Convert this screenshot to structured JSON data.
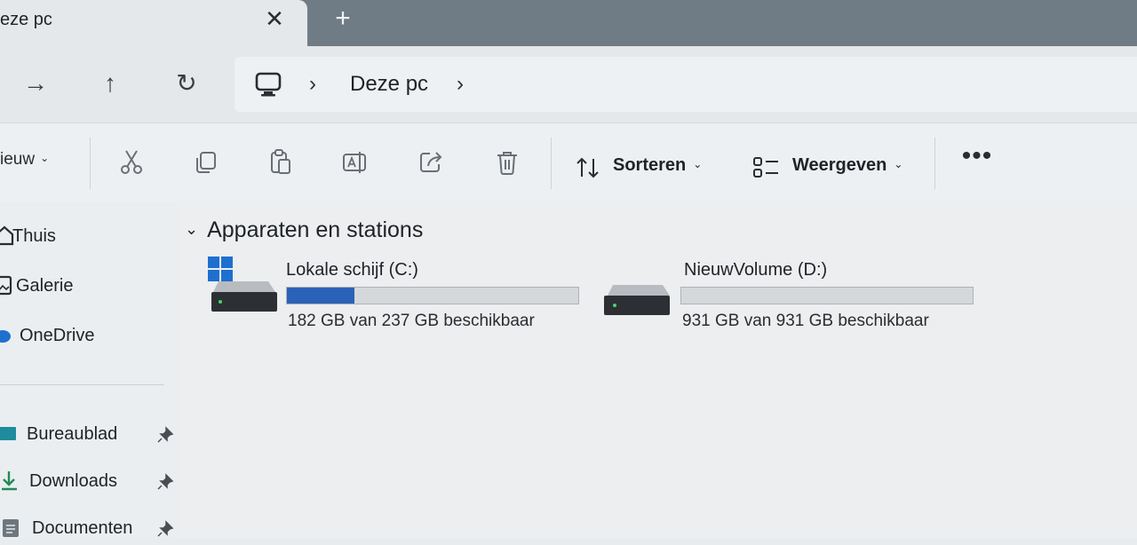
{
  "tab": {
    "title": "eze pc",
    "close_glyph": "✕",
    "new_tab_glyph": "+"
  },
  "nav": {
    "forward_glyph": "→",
    "up_glyph": "↑",
    "refresh_glyph": "↻",
    "breadcrumb": [
      "Deze pc"
    ],
    "chevron_glyph": "›"
  },
  "commandbar": {
    "new_label": "ieuw",
    "sort_label": "Sorteren",
    "view_label": "Weergeven",
    "more_glyph": "•••",
    "icons": [
      "cut-icon",
      "copy-icon",
      "paste-icon",
      "rename-icon",
      "share-icon",
      "delete-icon"
    ]
  },
  "sidebar": {
    "items": [
      {
        "label": "Thuis",
        "icon": "home-icon"
      },
      {
        "label": "Galerie",
        "icon": "gallery-icon"
      },
      {
        "label": "OneDrive",
        "icon": "onedrive-icon"
      }
    ],
    "pinned": [
      {
        "label": "Bureaublad",
        "icon": "desktop-icon"
      },
      {
        "label": "Downloads",
        "icon": "download-icon"
      },
      {
        "label": "Documenten",
        "icon": "documents-icon"
      }
    ]
  },
  "content": {
    "group_title": "Apparaten en stations",
    "drives": [
      {
        "name": "Lokale schijf (C:)",
        "info": "182 GB van 237 GB beschikbaar",
        "used_fraction": 0.232,
        "icon": "windows-drive-icon"
      },
      {
        "name": "NieuwVolume (D:)",
        "info": "931 GB van 931 GB beschikbaar",
        "used_fraction": 0.0,
        "icon": "drive-icon"
      }
    ]
  },
  "colors": {
    "accent": "#2a62b8",
    "windows_blue": "#1e6fd0",
    "drive_body": "#2c3035"
  }
}
